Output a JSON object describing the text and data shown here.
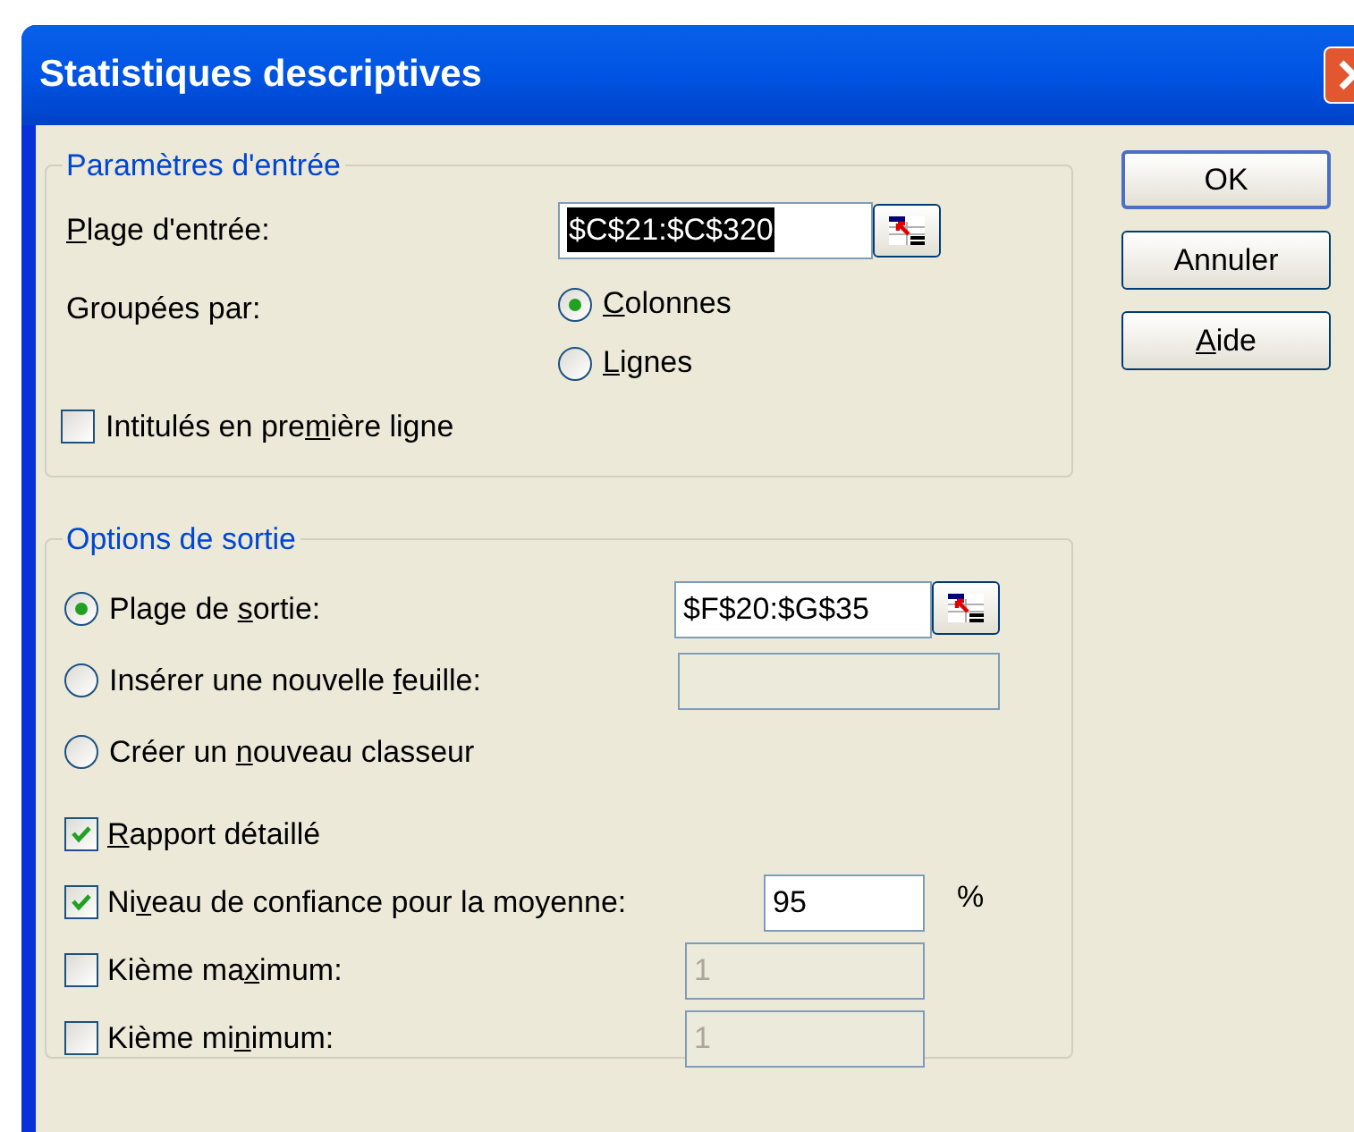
{
  "window": {
    "title": "Statistiques descriptives"
  },
  "input_group": {
    "legend": "Paramètres d'entrée",
    "input_range": {
      "label": {
        "key": "P",
        "post": "lage d'entrée:"
      },
      "value": "$C$21:$C$320",
      "selected": true,
      "picker": true
    },
    "grouped_by": {
      "label": "Groupées par:",
      "options": [
        {
          "label": {
            "key": "C",
            "post": "olonnes"
          },
          "selected": true
        },
        {
          "label": {
            "key": "L",
            "post": "ignes"
          },
          "selected": false
        }
      ]
    },
    "labels_in_first_row": {
      "label": {
        "pre": "Intitulés en pre",
        "key": "m",
        "post": "ière ligne"
      },
      "checked": false
    }
  },
  "output_group": {
    "legend": "Options de sortie",
    "destinations": [
      {
        "label": {
          "pre": "Plage de ",
          "key": "s",
          "post": "ortie:"
        },
        "selected": true,
        "field": {
          "value": "$F$20:$G$35",
          "disabled": false,
          "picker": true
        }
      },
      {
        "label": {
          "pre": "Insérer une nouvelle ",
          "key": "f",
          "post": "euille:"
        },
        "selected": false,
        "field": {
          "disabled": true,
          "picker": false
        }
      },
      {
        "label": {
          "pre": "Créer un ",
          "key": "n",
          "post": "ouveau classeur"
        },
        "selected": false
      }
    ],
    "options": [
      {
        "label": {
          "key": "R",
          "post": "apport détaillé"
        },
        "checked": true
      },
      {
        "label": {
          "pre": "Ni",
          "key": "v",
          "post": "eau de confiance pour la moyenne:"
        },
        "checked": true,
        "field": {
          "value": "95",
          "disabled": false
        },
        "unit": "%"
      },
      {
        "label": {
          "pre": "Kième ma",
          "key": "x",
          "post": "imum:"
        },
        "checked": false,
        "field": {
          "value": "1",
          "disabled": true
        }
      },
      {
        "label": {
          "pre": "Kième mi",
          "key": "n",
          "post": "imum:"
        },
        "checked": false,
        "field": {
          "value": "1",
          "disabled": true
        }
      }
    ]
  },
  "buttons": [
    {
      "label": {
        "pre": "OK"
      },
      "default": true
    },
    {
      "label": {
        "pre": "Annuler"
      },
      "default": false
    },
    {
      "label": {
        "key": "A",
        "post": "ide"
      },
      "default": false
    }
  ]
}
